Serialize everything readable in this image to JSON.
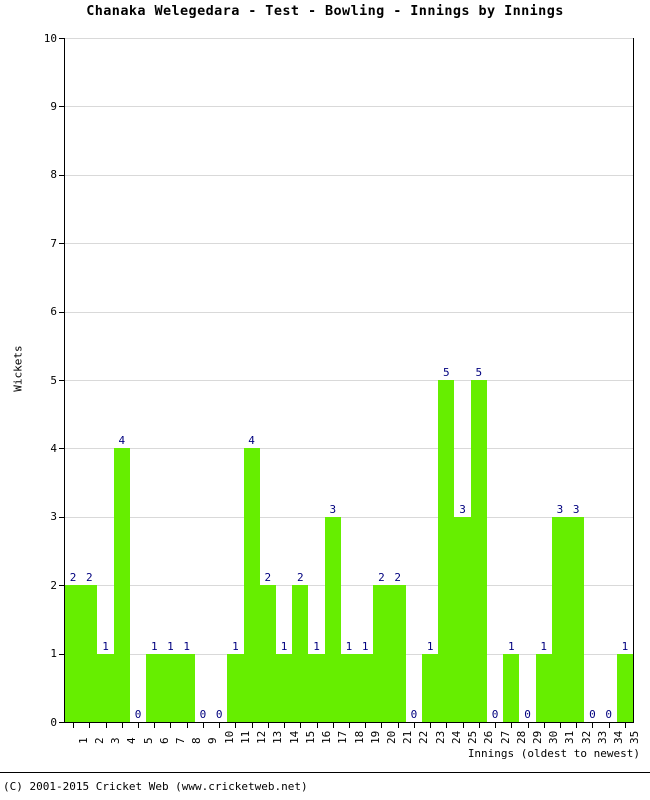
{
  "chart_data": {
    "type": "bar",
    "title": "Chanaka Welegedara - Test - Bowling - Innings by Innings",
    "xlabel": "Innings (oldest to newest)",
    "ylabel": "Wickets",
    "ylim": [
      0,
      10
    ],
    "ytick_labels": [
      "0",
      "1",
      "2",
      "3",
      "4",
      "5",
      "6",
      "7",
      "8",
      "9",
      "10"
    ],
    "ytick_values": [
      0,
      1,
      2,
      3,
      4,
      5,
      6,
      7,
      8,
      9,
      10
    ],
    "grid": true,
    "legend": "none",
    "bar_color": "#66ee00",
    "value_label_color": "#00007f",
    "categories": [
      "1",
      "2",
      "3",
      "4",
      "5",
      "6",
      "7",
      "8",
      "9",
      "10",
      "11",
      "12",
      "13",
      "14",
      "15",
      "16",
      "17",
      "18",
      "19",
      "20",
      "21",
      "22",
      "23",
      "24",
      "25",
      "26",
      "27",
      "28",
      "29",
      "30",
      "31",
      "32",
      "33",
      "34",
      "35"
    ],
    "values": [
      2,
      2,
      1,
      4,
      0,
      1,
      1,
      1,
      0,
      0,
      1,
      4,
      2,
      1,
      2,
      1,
      3,
      1,
      1,
      2,
      2,
      0,
      1,
      5,
      3,
      5,
      0,
      1,
      0,
      1,
      3,
      3,
      0,
      0,
      1
    ]
  },
  "footer": {
    "copyright": "(C) 2001-2015 Cricket Web (www.cricketweb.net)"
  }
}
